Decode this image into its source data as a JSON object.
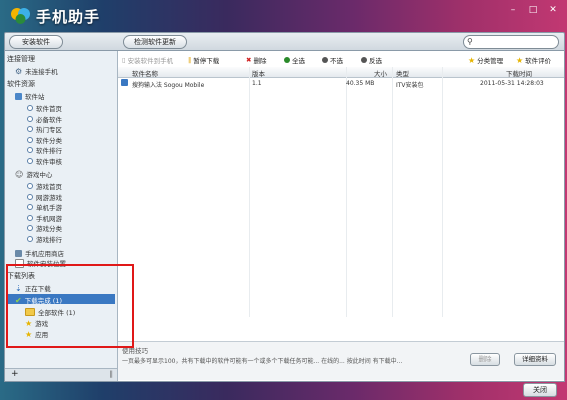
{
  "app": {
    "title": "手机助手"
  },
  "toolbar": {
    "install_software": "安装软件",
    "check_updates": "检测软件更新",
    "search_placeholder": ""
  },
  "sidebar": {
    "device_section": "连接管理",
    "device_item": "未连接手机",
    "store_section": "软件资源",
    "software_station": "软件站",
    "software_items": [
      "软件首页",
      "必备软件",
      "热门专区",
      "软件分类",
      "软件排行",
      "软件审核"
    ],
    "game_center": "游戏中心",
    "game_items": [
      "游戏首页",
      "网游游戏",
      "单机手游",
      "手机网游",
      "游戏分类",
      "游戏排行"
    ],
    "apps_link": "手机应用商店",
    "other_item": "软件安装位置",
    "download_section": "下载列表",
    "downloading": "正在下载",
    "download_done": "下载完成 (1)",
    "done_children": [
      "全部软件 (1)",
      "游戏",
      "应用"
    ],
    "bottom_plus": "+"
  },
  "actions": {
    "install_to_phone": "安装软件到手机",
    "pause_download": "暂停下载",
    "delete": "删除",
    "select_all": "全选",
    "deselect": "不选",
    "invert": "反选",
    "category_manage": "分类管理",
    "software_review": "软件评价"
  },
  "table": {
    "headers": [
      "软件名称",
      "版本",
      "大小",
      "类型",
      "下载时间"
    ],
    "rows": [
      {
        "name": "搜狗输入法 Sogou Mobile",
        "version": "1.1",
        "size": "40.35 MB",
        "type": "ITV安装包",
        "time": "2011-05-31 14:28:03"
      }
    ]
  },
  "infobar": {
    "title": "使用技巧",
    "tip": "一页最多可显示100，共有下载中的软件可能有一个或多个下载任务可能... 在线的... 按此时间 有下载中...",
    "btn_delete": "删除",
    "btn_detail": "详细资料"
  },
  "footer": {
    "close": "关闭"
  }
}
